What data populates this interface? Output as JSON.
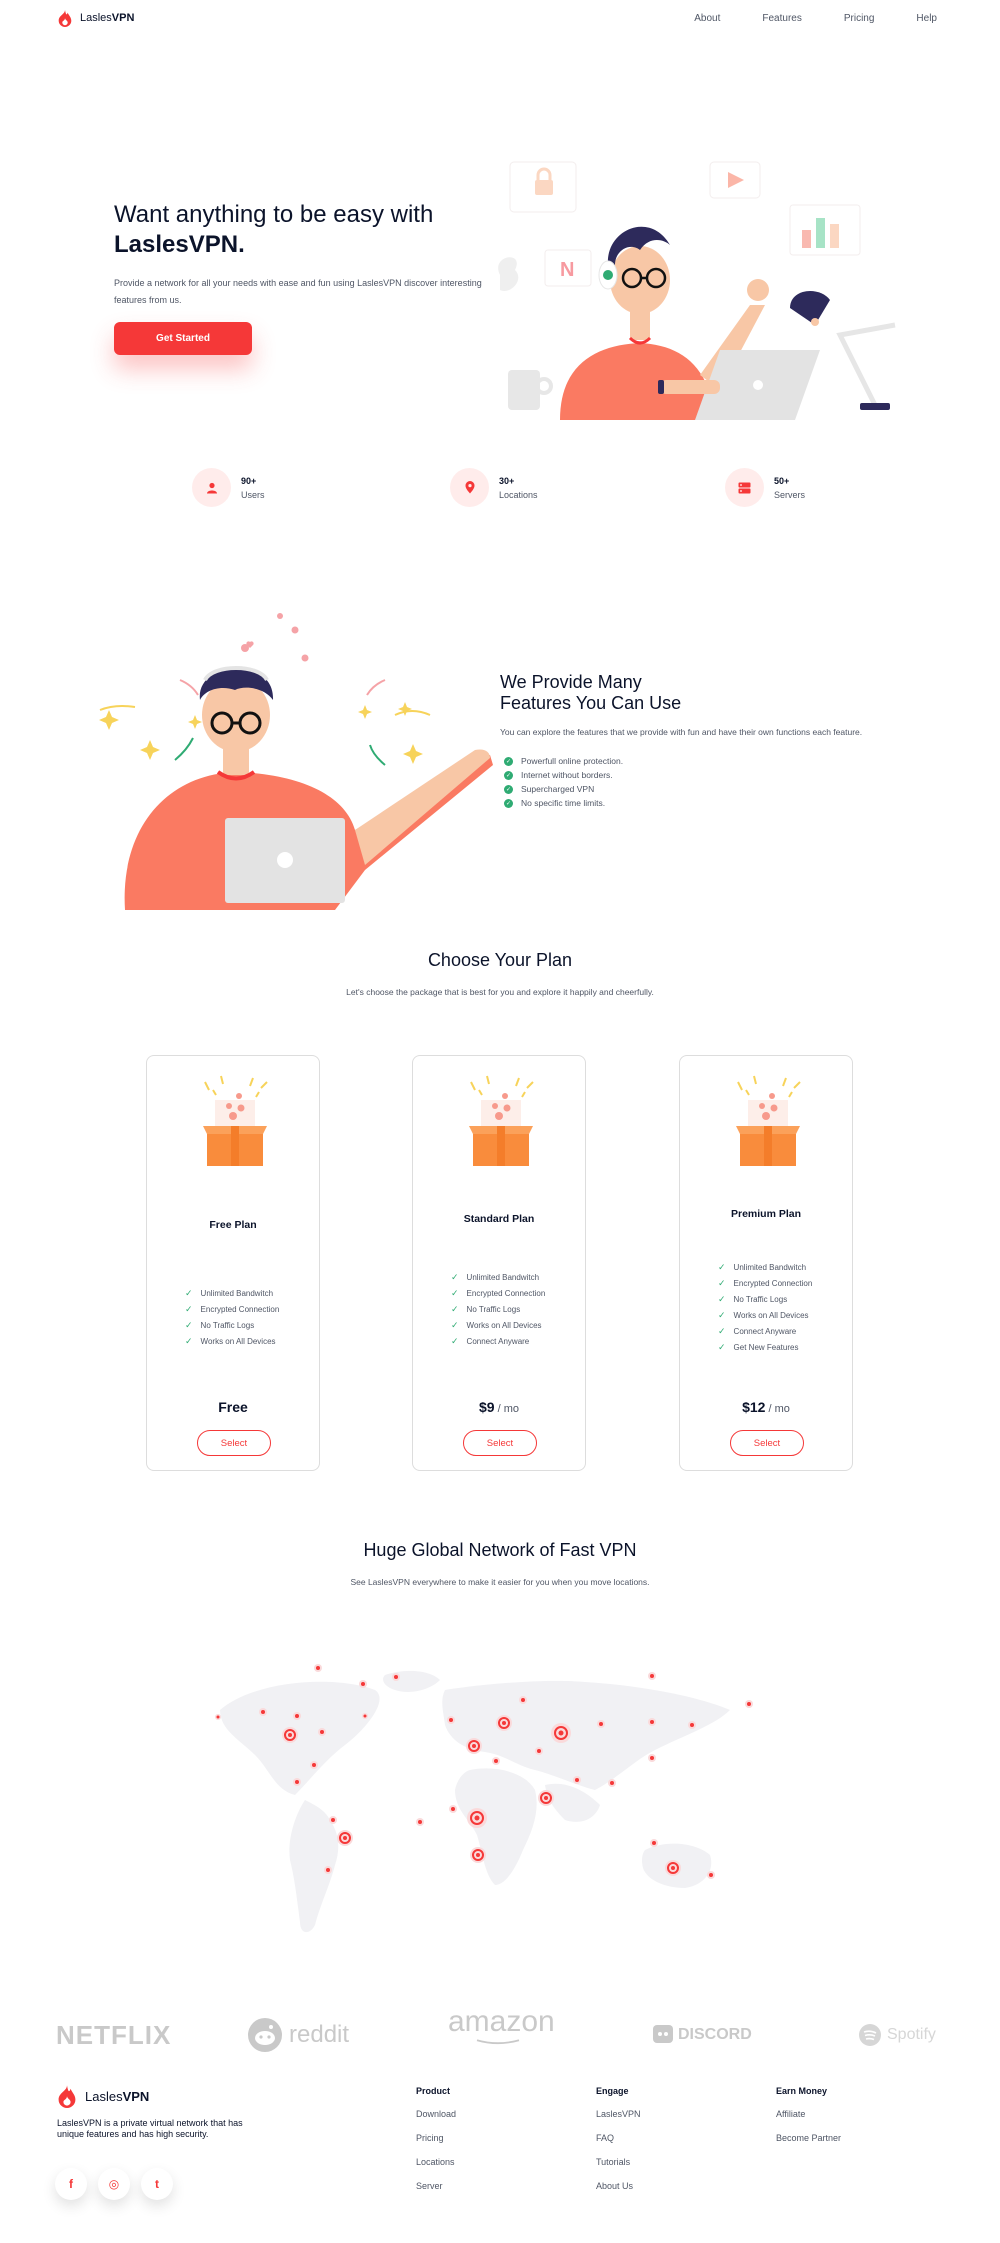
{
  "brand": {
    "name_prefix": "Lasles",
    "name_suffix": "VPN",
    "accent": "#f53838",
    "success": "#2fab73"
  },
  "nav": {
    "links": [
      "About",
      "Features",
      "Pricing",
      "Help"
    ]
  },
  "hero": {
    "title_line1": "Want anything to be easy with",
    "title_line2": "LaslesVPN.",
    "description": "Provide a network for all your needs with ease and fun using LaslesVPN discover interesting features from us.",
    "cta": "Get Started"
  },
  "stats": [
    {
      "icon": "user-icon",
      "number": "90+",
      "label": "Users"
    },
    {
      "icon": "location-pin-icon",
      "number": "30+",
      "label": "Locations"
    },
    {
      "icon": "server-icon",
      "number": "50+",
      "label": "Servers"
    }
  ],
  "features": {
    "title_line1": "We Provide Many",
    "title_line2": "Features You Can Use",
    "description": "You can explore the features that we provide with fun and have their own functions each feature.",
    "items": [
      "Powerfull online protection.",
      "Internet without borders.",
      "Supercharged VPN",
      "No specific time limits."
    ]
  },
  "plans": {
    "title": "Choose Your Plan",
    "subtitle": "Let's choose the package that is best for you and explore it happily and cheerfully.",
    "items": [
      {
        "name": "Free Plan",
        "features": [
          "Unlimited Bandwitch",
          "Encrypted Connection",
          "No Traffic Logs",
          "Works on All Devices"
        ],
        "price": "Free",
        "per": "",
        "button": "Select"
      },
      {
        "name": "Standard Plan",
        "features": [
          "Unlimited Bandwitch",
          "Encrypted Connection",
          "No Traffic Logs",
          "Works on All Devices",
          "Connect Anyware"
        ],
        "price": "$9",
        "per": " / mo",
        "button": "Select"
      },
      {
        "name": "Premium Plan",
        "features": [
          "Unlimited Bandwitch",
          "Encrypted Connection",
          "No Traffic Logs",
          "Works on All Devices",
          "Connect Anyware",
          "Get New Features"
        ],
        "price": "$12",
        "per": " / mo",
        "button": "Select"
      }
    ]
  },
  "network": {
    "title": "Huge Global Network of Fast VPN",
    "subtitle": "See LaslesVPN everywhere to make it easier for you when you move locations."
  },
  "partners": [
    "NETFLIX",
    "reddit",
    "amazon",
    "DISCORD",
    "Spotify"
  ],
  "footer": {
    "description": "LaslesVPN is a private virtual network that has unique features and has high security.",
    "social": [
      {
        "icon": "facebook-icon",
        "glyph": "f"
      },
      {
        "icon": "instagram-icon",
        "glyph": "◎"
      },
      {
        "icon": "twitter-icon",
        "glyph": "t"
      }
    ],
    "columns": [
      {
        "heading": "Product",
        "items": [
          "Download",
          "Pricing",
          "Locations",
          "Server"
        ]
      },
      {
        "heading": "Engage",
        "items": [
          "LaslesVPN",
          "FAQ",
          "Tutorials",
          "About Us"
        ]
      },
      {
        "heading": "Earn Money",
        "items": [
          "Affiliate",
          "Become Partner"
        ]
      }
    ]
  }
}
